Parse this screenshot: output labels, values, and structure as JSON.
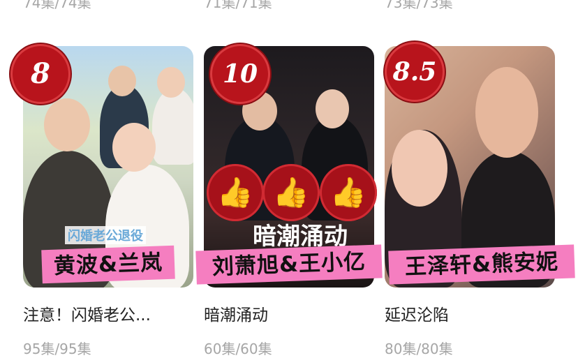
{
  "top_counts": [
    "74集/74集",
    "71集/71集",
    "73集/73集"
  ],
  "items": [
    {
      "rating": "8",
      "overlay_label": "黄波&兰岚",
      "poster_text": "闪婚老公退役",
      "title": "注意！闪婚老公...",
      "episodes": "95集/95集"
    },
    {
      "rating": "10",
      "overlay_label": "刘萧旭&王小亿",
      "poster_text": "暗潮涌动",
      "title": "暗潮涌动",
      "episodes": "60集/60集"
    },
    {
      "rating": "8.5",
      "overlay_label": "王泽轩&熊安妮",
      "poster_text": "",
      "title": "延迟沦陷",
      "episodes": "80集/80集"
    }
  ],
  "thumbs_icon": "thumbs-up-icon",
  "colors": {
    "rating_badge": "#b8141c",
    "label_bg": "#f57ec0",
    "meta_text": "#a6a6a6",
    "title_text": "#222222"
  }
}
